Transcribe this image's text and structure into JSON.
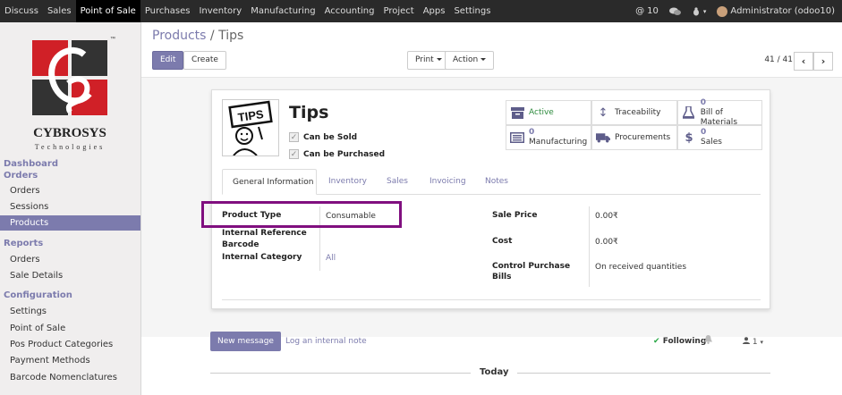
{
  "topbar": {
    "menu": [
      "Discuss",
      "Sales",
      "Point of Sale",
      "Purchases",
      "Inventory",
      "Manufacturing",
      "Accounting",
      "Project",
      "Apps",
      "Settings"
    ],
    "active_index": 2,
    "messages_count": "10",
    "user": "Administrator (odoo10)"
  },
  "sidebar": {
    "logo_text": "CYBROSYS",
    "logo_sub": "Technologies",
    "logo_tm": "™",
    "sections": {
      "dashboard": "Dashboard",
      "orders": "Orders",
      "reports": "Reports",
      "configuration": "Configuration"
    },
    "items": {
      "orders": "Orders",
      "sessions": "Sessions",
      "products": "Products",
      "report_orders": "Orders",
      "sale_details": "Sale Details",
      "settings": "Settings",
      "point_of_sale": "Point of Sale",
      "pos_categories": "Pos Product Categories",
      "payment_methods": "Payment Methods",
      "barcode_nomenclatures": "Barcode Nomenclatures"
    }
  },
  "breadcrumb": {
    "parent": "Products",
    "separator": "/",
    "current": "Tips"
  },
  "buttons": {
    "edit": "Edit",
    "create": "Create",
    "print": "Print",
    "action": "Action"
  },
  "pager": {
    "value": "41 / 41"
  },
  "product": {
    "image_text": "TIPS",
    "name": "Tips",
    "can_be_sold": "Can be Sold",
    "can_be_purchased": "Can be Purchased"
  },
  "smart_buttons": {
    "active": "Active",
    "traceability": "Traceability",
    "bom_count": "0",
    "bom_label": "Bill of Materials",
    "mfg_count": "0",
    "mfg_label": "Manufacturing",
    "procurements": "Procurements",
    "sales_count": "0",
    "sales_label": "Sales"
  },
  "tabs": [
    "General Information",
    "Inventory",
    "Sales",
    "Invoicing",
    "Notes"
  ],
  "fields": {
    "product_type_label": "Product Type",
    "product_type_value": "Consumable",
    "internal_reference_label": "Internal Reference",
    "barcode_label": "Barcode",
    "internal_category_label": "Internal Category",
    "internal_category_value": "All",
    "sale_price_label": "Sale Price",
    "sale_price_value": "0.00₹",
    "cost_label": "Cost",
    "cost_value": "0.00₹",
    "control_purchase_label_1": "Control Purchase",
    "control_purchase_label_2": "Bills",
    "control_purchase_value": "On received quantities"
  },
  "chatter": {
    "new_message": "New message",
    "log_note": "Log an internal note",
    "following": "Following",
    "followers_count": "1",
    "today": "Today"
  },
  "colors": {
    "accent": "#7c7bad",
    "highlight": "#800f7f",
    "navbar": "#2a2a2a",
    "logo_red": "#d02027"
  }
}
